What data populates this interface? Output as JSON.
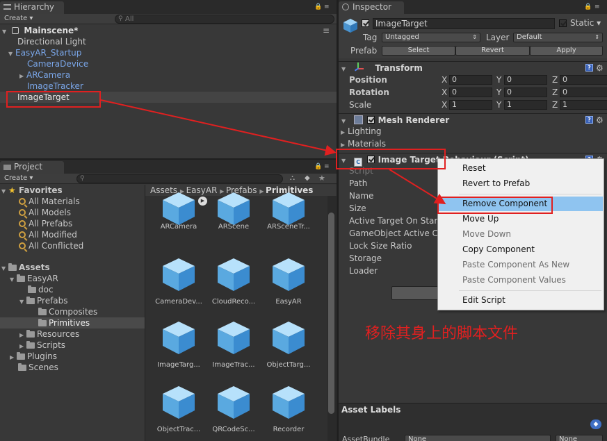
{
  "hierarchy": {
    "tab": "Hierarchy",
    "create": "Create ▾",
    "search_placeholder": "All",
    "scene": "Mainscene*",
    "items": [
      {
        "label": "Directional Light"
      },
      {
        "label": "EasyAR_Startup"
      },
      {
        "label": "CameraDevice"
      },
      {
        "label": "ARCamera"
      },
      {
        "label": "ImageTracker"
      },
      {
        "label": "ImageTarget"
      }
    ]
  },
  "project": {
    "tab": "Project",
    "create": "Create ▾",
    "favorites_title": "Favorites",
    "favorites": [
      "All Materials",
      "All Models",
      "All Prefabs",
      "All Modified",
      "All Conflicted"
    ],
    "assets_title": "Assets",
    "tree": [
      "EasyAR",
      "doc",
      "Prefabs",
      "Composites",
      "Primitives",
      "Resources",
      "Scripts",
      "Plugins",
      "Scenes"
    ],
    "breadcrumb": [
      "Assets",
      "EasyAR",
      "Prefabs",
      "Primitives"
    ],
    "grid": [
      "ARCamera",
      "ARScene",
      "ARSceneTr...",
      "CameraDev...",
      "CloudReco...",
      "EasyAR",
      "ImageTarg...",
      "ImageTrac...",
      "ObjectTarg...",
      "ObjectTrac...",
      "QRCodeSc...",
      "Recorder"
    ]
  },
  "inspector": {
    "tab": "Inspector",
    "object_name": "ImageTarget",
    "static_label": "Static ▾",
    "tag_label": "Tag",
    "tag_value": "Untagged",
    "layer_label": "Layer",
    "layer_value": "Default",
    "prefab_label": "Prefab",
    "select": "Select",
    "revert": "Revert",
    "apply": "Apply",
    "transform": {
      "title": "Transform",
      "position": "Position",
      "rotation": "Rotation",
      "scale": "Scale",
      "x": "X",
      "y": "Y",
      "z": "Z",
      "pos": [
        "0",
        "0",
        "0"
      ],
      "rot": [
        "0",
        "0",
        "0"
      ],
      "scl": [
        "1",
        "1",
        "1"
      ]
    },
    "mesh_renderer": {
      "title": "Mesh Renderer",
      "lighting": "Lighting",
      "materials": "Materials"
    },
    "script_comp": {
      "title": "Image Target Behaviour (Script)",
      "props": [
        "Script",
        "Path",
        "Name",
        "Size",
        "Active Target On Start",
        "GameObject Active Co",
        "Lock Size Ratio",
        "Storage",
        "Loader"
      ]
    },
    "add_btn": "A",
    "asset_labels": "Asset Labels",
    "assetbundle_label": "AssetBundle",
    "ab_none1": "None",
    "ab_none2": "None"
  },
  "context_menu": {
    "items": [
      "Reset",
      "Revert to Prefab",
      "Remove Component",
      "Move Up",
      "Move Down",
      "Copy Component",
      "Paste Component As New",
      "Paste Component Values",
      "Edit Script"
    ]
  },
  "annotation": "移除其身上的脚本文件",
  "colors": {
    "accent_red": "#e02020",
    "menu_highlight": "#8fc4f0",
    "link_blue": "#7aa6e8"
  }
}
